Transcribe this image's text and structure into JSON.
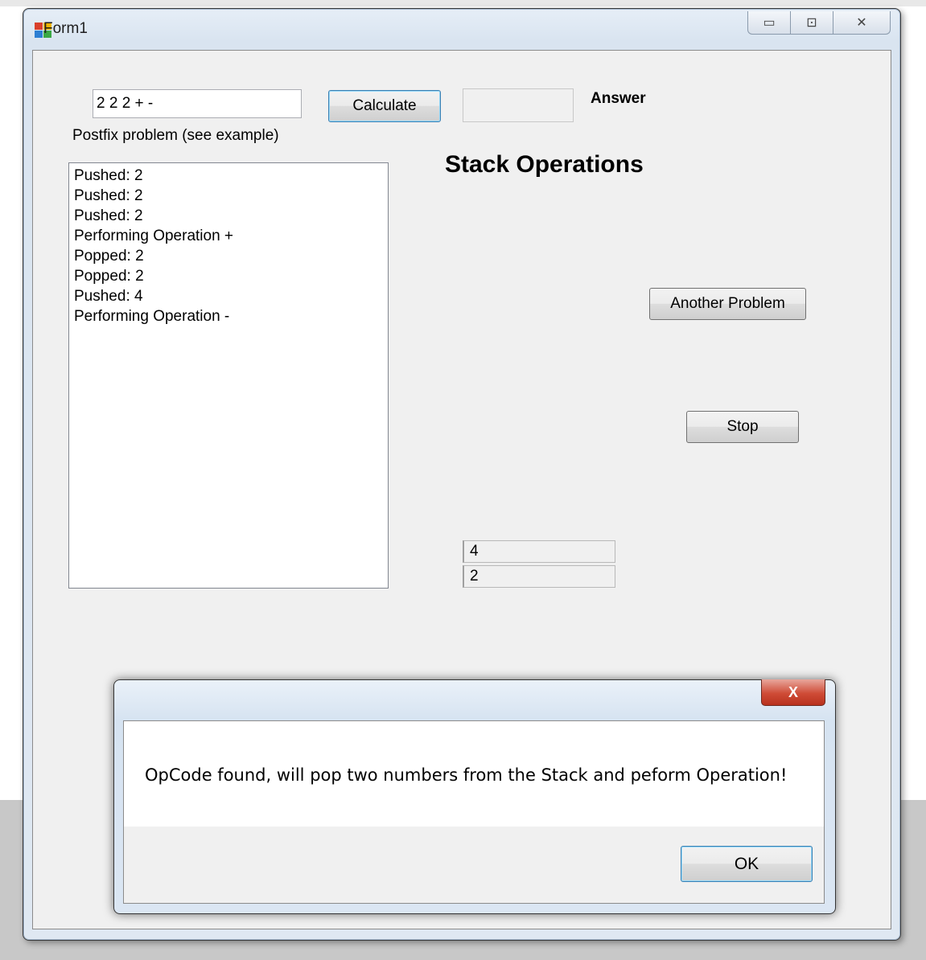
{
  "window": {
    "title": "Form1",
    "controls": {
      "minimize": "▭",
      "maximize": "⊡",
      "close": "✕"
    }
  },
  "form": {
    "postfix_input_value": "2 2 2 + -",
    "postfix_label": "Postfix problem (see example)",
    "calculate_label": "Calculate",
    "answer_value": "",
    "answer_label": "Answer",
    "stack_heading": "Stack Operations",
    "another_problem_label": "Another Problem",
    "stop_label": "Stop",
    "log": [
      "Pushed: 2",
      "Pushed: 2",
      "Pushed: 2",
      "Performing Operation +",
      "Popped: 2",
      "Popped: 2",
      "Pushed: 4",
      "Performing Operation -"
    ],
    "stack_values": [
      "4",
      "2"
    ]
  },
  "dialog": {
    "close_glyph": "X",
    "message": "OpCode found, will pop two numbers from the Stack and peform Operation!",
    "ok_label": "OK"
  },
  "colors": {
    "window_bg": "#f0f0f0",
    "close_red": "#cf4b36",
    "focus_blue": "#3c7fb1"
  }
}
